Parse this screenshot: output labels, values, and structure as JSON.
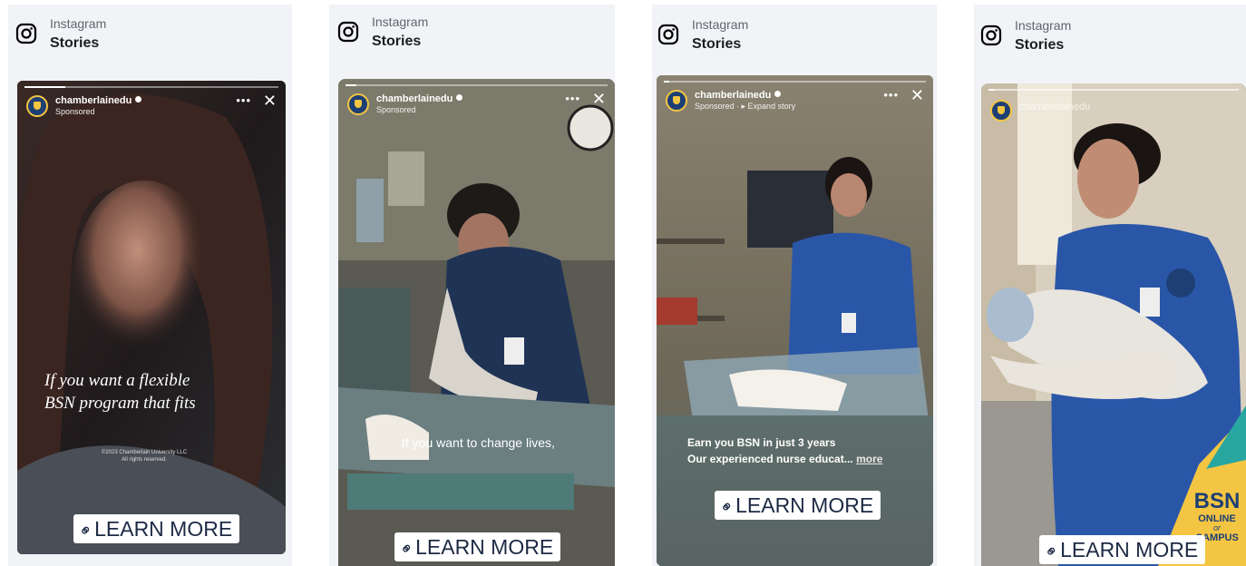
{
  "panels": [
    {
      "platform": "Instagram",
      "placement": "Stories",
      "username": "chamberlainedu",
      "sponsored": "Sponsored",
      "more_menu": "•••",
      "close": "✕",
      "caption_line1": "If you want a flexible",
      "caption_line2": "BSN program that fits",
      "copyright_line1": "©2023 Chamberlain University LLC",
      "copyright_line2": "All rights reserved.",
      "cta": "LEARN MORE"
    },
    {
      "platform": "Instagram",
      "placement": "Stories",
      "username": "chamberlainedu",
      "sponsored": "Sponsored",
      "more_menu": "•••",
      "close": "✕",
      "subtitle": "If you want to change lives,",
      "cta": "LEARN MORE"
    },
    {
      "platform": "Instagram",
      "placement": "Stories",
      "username": "chamberlainedu",
      "sponsored": "Sponsored · ▸ Expand story",
      "more_menu": "•••",
      "close": "✕",
      "caption_line1": "Earn you BSN in just 3 years",
      "caption_line2": "Our experienced nurse educat...",
      "caption_more": "more",
      "cta": "LEARN MORE"
    },
    {
      "platform": "Instagram",
      "placement": "Stories",
      "username": "chamberlainedu",
      "bsn_big": "BSN",
      "bsn_online": "ONLINE",
      "bsn_or": "or",
      "bsn_campus": "CAMPUS",
      "cta": "LEARN MORE"
    }
  ],
  "colors": {
    "panel_bg": "#f1f3f6",
    "brand_navy": "#1d3f74",
    "brand_gold": "#f4c542",
    "scrub_blue": "#2a56a8"
  },
  "icons": [
    "instagram-icon",
    "verified-icon",
    "link-icon",
    "close-icon",
    "more-icon"
  ]
}
